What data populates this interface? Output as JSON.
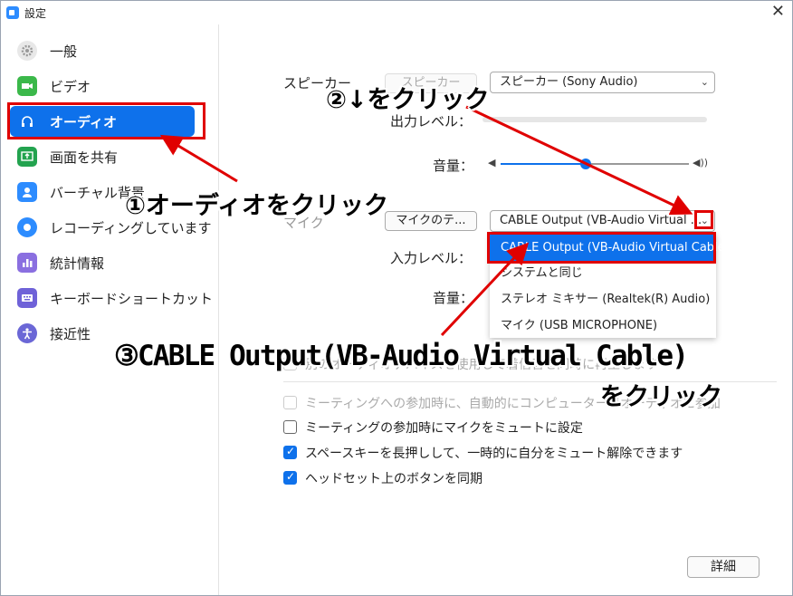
{
  "window": {
    "title": "設定",
    "close_icon": "close-icon"
  },
  "sidebar": {
    "items": [
      {
        "label": "一般",
        "icon": "gear-icon"
      },
      {
        "label": "ビデオ",
        "icon": "video-camera-icon"
      },
      {
        "label": "オーディオ",
        "icon": "headphones-icon",
        "active": true
      },
      {
        "label": "画面を共有",
        "icon": "share-screen-icon"
      },
      {
        "label": "バーチャル背景",
        "icon": "person-background-icon"
      },
      {
        "label": "レコーディングしています",
        "icon": "record-icon"
      },
      {
        "label": "統計情報",
        "icon": "bar-chart-icon"
      },
      {
        "label": "キーボードショートカット",
        "icon": "keyboard-icon"
      },
      {
        "label": "接近性",
        "icon": "accessibility-icon"
      }
    ]
  },
  "speaker": {
    "label": "スピーカー",
    "test_button": "スピーカー",
    "selected": "スピーカー (Sony Audio)",
    "output_level_label": "出力レベル：",
    "volume_label": "音量：",
    "volume_level": 0.45
  },
  "mic": {
    "label": "マイク",
    "test_button": "マイクのテ...",
    "selected": "CABLE Output (VB-Audio Virtual ...",
    "input_level_label": "入力レベル：",
    "volume_label": "音量："
  },
  "mic_dropdown": {
    "options": [
      "CABLE Output (VB-Audio Virtual Cable)",
      "システムと同じ",
      "ステレオ ミキサー (Realtek(R) Audio)",
      "マイク (USB MICROPHONE)"
    ],
    "selected_index": 0
  },
  "hidden_option": "別のオーディオデバイスを使用して着信音を同時に再生します",
  "checkboxes": [
    {
      "label": "ミーティングへの参加時に、自動的にコンピューターでオーディオに参加",
      "checked": false,
      "disabled": true
    },
    {
      "label": "ミーティングの参加時にマイクをミュートに設定",
      "checked": false,
      "disabled": false
    },
    {
      "label": "スペースキーを長押しして、一時的に自分をミュート解除できます",
      "checked": true,
      "disabled": false
    },
    {
      "label": "ヘッドセット上のボタンを同期",
      "checked": true,
      "disabled": false
    }
  ],
  "details_button": "詳細",
  "annotations": {
    "step1": "①オーディオをクリック",
    "step2": "②↓をクリック",
    "step3_line1": "③CABLE Output(VB-Audio Virtual Cable)",
    "step3_line2": "をクリック",
    "color": "#e00000"
  },
  "colors": {
    "accent": "#0e71eb",
    "annotation": "#e00000"
  }
}
